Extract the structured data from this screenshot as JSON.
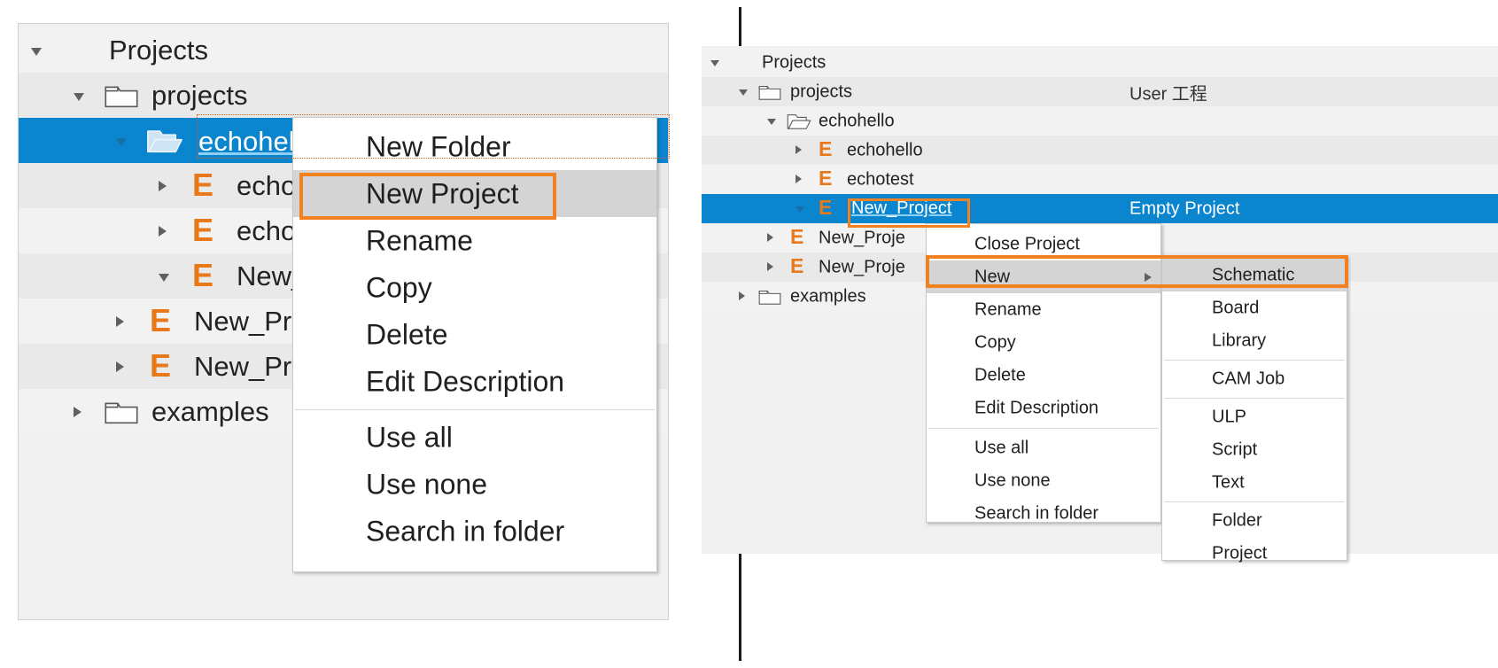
{
  "left_panel": {
    "tree": [
      {
        "label": "Projects",
        "icon": "none",
        "twisty": "down",
        "indent": 0,
        "selected": false
      },
      {
        "label": "projects",
        "icon": "folder-closed",
        "twisty": "down",
        "indent": 1,
        "selected": false
      },
      {
        "label": "echohello",
        "icon": "folder-open",
        "twisty": "down",
        "indent": 2,
        "selected": true,
        "editing": true
      },
      {
        "label": "echohello",
        "icon": "e-icon",
        "twisty": "right",
        "indent": 3,
        "selected": false
      },
      {
        "label": "echotest",
        "icon": "e-icon",
        "twisty": "right",
        "indent": 3,
        "selected": false
      },
      {
        "label": "New_Project",
        "icon": "e-icon",
        "twisty": "down",
        "indent": 3,
        "selected": false
      },
      {
        "label": "New_Project",
        "icon": "e-icon",
        "twisty": "right",
        "indent": 2,
        "selected": false
      },
      {
        "label": "New_Project",
        "icon": "e-icon",
        "twisty": "right",
        "indent": 2,
        "selected": false
      },
      {
        "label": "examples",
        "icon": "folder-closed",
        "twisty": "right",
        "indent": 1,
        "selected": false
      }
    ]
  },
  "left_context_menu": {
    "items": [
      {
        "label": "New Folder",
        "highlighted": false,
        "separator_after": false
      },
      {
        "label": "New Project",
        "highlighted": true,
        "separator_after": false
      },
      {
        "label": "Rename",
        "highlighted": false,
        "separator_after": false
      },
      {
        "label": "Copy",
        "highlighted": false,
        "separator_after": false
      },
      {
        "label": "Delete",
        "highlighted": false,
        "separator_after": false
      },
      {
        "label": "Edit Description",
        "highlighted": false,
        "separator_after": true
      },
      {
        "label": "Use all",
        "highlighted": false,
        "separator_after": false
      },
      {
        "label": "Use none",
        "highlighted": false,
        "separator_after": false
      },
      {
        "label": "Search in folder",
        "highlighted": false,
        "separator_after": false
      }
    ]
  },
  "right_panel": {
    "tree": [
      {
        "label": "Projects",
        "icon": "none",
        "twisty": "down",
        "indent": 0,
        "selected": false,
        "note": "",
        "dot": ""
      },
      {
        "label": "projects",
        "icon": "folder-closed",
        "twisty": "down",
        "indent": 1,
        "selected": false,
        "note": "User 工程",
        "dot": ""
      },
      {
        "label": "echohello",
        "icon": "folder-open",
        "twisty": "down",
        "indent": 2,
        "selected": false,
        "note": "",
        "dot": ""
      },
      {
        "label": "echohello",
        "icon": "e-icon",
        "twisty": "right",
        "indent": 3,
        "selected": false,
        "note": "",
        "dot": "gray"
      },
      {
        "label": "echotest",
        "icon": "e-icon",
        "twisty": "right",
        "indent": 3,
        "selected": false,
        "note": "",
        "dot": "gray"
      },
      {
        "label": "New_Project",
        "icon": "e-icon",
        "twisty": "down",
        "indent": 3,
        "selected": true,
        "editing": true,
        "note": "Empty Project",
        "dot": "green"
      },
      {
        "label": "New_Proje",
        "icon": "e-icon",
        "twisty": "right",
        "indent": 2,
        "selected": false,
        "note": "",
        "dot": ""
      },
      {
        "label": "New_Proje",
        "icon": "e-icon",
        "twisty": "right",
        "indent": 2,
        "selected": false,
        "note": "",
        "dot": ""
      },
      {
        "label": "examples",
        "icon": "folder-closed",
        "twisty": "right",
        "indent": 1,
        "selected": false,
        "note": "",
        "dot": ""
      }
    ]
  },
  "right_context_menu": {
    "items": [
      {
        "label": "Close Project",
        "highlighted": false,
        "submenu": false,
        "separator_after": false
      },
      {
        "label": "New",
        "highlighted": true,
        "submenu": true,
        "separator_after": false
      },
      {
        "label": "Rename",
        "highlighted": false,
        "submenu": false,
        "separator_after": false
      },
      {
        "label": "Copy",
        "highlighted": false,
        "submenu": false,
        "separator_after": false
      },
      {
        "label": "Delete",
        "highlighted": false,
        "submenu": false,
        "separator_after": false
      },
      {
        "label": "Edit Description",
        "highlighted": false,
        "submenu": false,
        "separator_after": true
      },
      {
        "label": "Use all",
        "highlighted": false,
        "submenu": false,
        "separator_after": false
      },
      {
        "label": "Use none",
        "highlighted": false,
        "submenu": false,
        "separator_after": false
      },
      {
        "label": "Search in folder",
        "highlighted": false,
        "submenu": false,
        "separator_after": false
      }
    ]
  },
  "right_submenu": {
    "items": [
      {
        "label": "Schematic",
        "highlighted": true,
        "separator_after": false
      },
      {
        "label": "Board",
        "highlighted": false,
        "separator_after": false
      },
      {
        "label": "Library",
        "highlighted": false,
        "separator_after": true
      },
      {
        "label": "CAM Job",
        "highlighted": false,
        "separator_after": true
      },
      {
        "label": "ULP",
        "highlighted": false,
        "separator_after": false
      },
      {
        "label": "Script",
        "highlighted": false,
        "separator_after": false
      },
      {
        "label": "Text",
        "highlighted": false,
        "separator_after": true
      },
      {
        "label": "Folder",
        "highlighted": false,
        "separator_after": false
      },
      {
        "label": "Project",
        "highlighted": false,
        "separator_after": false
      }
    ]
  },
  "colors": {
    "selection_blue": "#0a85ce",
    "highlight_orange": "#F08020",
    "eagle_orange": "#E8791A",
    "menu_highlight_gray": "#d4d4d4",
    "panel_gray": "#f0f0f0",
    "row_alt_gray": "#eaeaea",
    "status_green": "#1ea32a",
    "status_gray": "#5a5a5a"
  }
}
